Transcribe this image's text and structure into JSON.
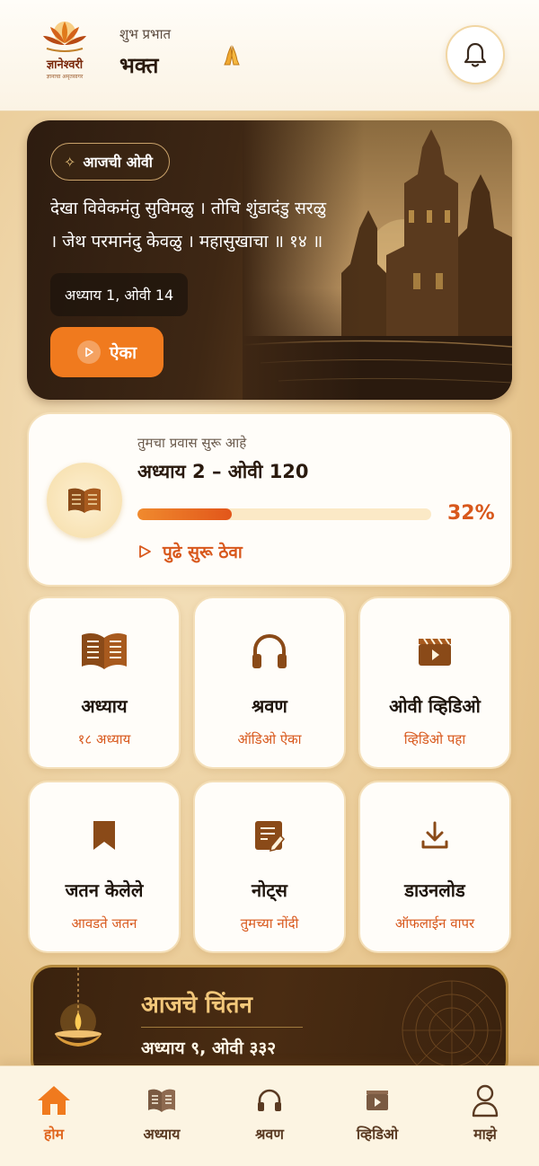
{
  "header": {
    "logo_title": "ज्ञानेश्वरी",
    "logo_subtitle": "ज्ञानाचा अमृतसागर",
    "greeting": "शुभ प्रभात",
    "username": "भक्त"
  },
  "hero": {
    "tag_label": "आजची ओवी",
    "verse_line1": "देखा विवेकमंतु सुविमळु । तोचि शुंडादंडु सरळु",
    "verse_line2": "। जेथ परमानंदु केवळु । महासुखाचा ॥ १४ ॥",
    "reference": "अध्याय 1, ओवी 14",
    "listen_label": "ऐका"
  },
  "progress": {
    "subtitle": "तुमचा प्रवास सुरू आहे",
    "title": "अध्याय 2 – ओवी 120",
    "percent_label": "32%",
    "percent_value": 32,
    "continue_label": "पुढे सुरू ठेवा"
  },
  "tiles": [
    {
      "title": "अध्याय",
      "subtitle": "१८ अध्याय",
      "icon": "open-book-icon"
    },
    {
      "title": "श्रवण",
      "subtitle": "ऑडिओ ऐका",
      "icon": "headphones-icon"
    },
    {
      "title": "ओवी व्हिडिओ",
      "subtitle": "व्हिडिओ पहा",
      "icon": "video-clapper-icon"
    },
    {
      "title": "जतन केलेले",
      "subtitle": "आवडते जतन",
      "icon": "bookmark-icon"
    },
    {
      "title": "नोट्स",
      "subtitle": "तुमच्या नोंदी",
      "icon": "notes-icon"
    },
    {
      "title": "डाउनलोड",
      "subtitle": "ऑफलाईन वापर",
      "icon": "download-icon"
    }
  ],
  "chintan": {
    "title": "आजचे चिंतन",
    "subtitle": "अध्याय ९, ओवी ३३२"
  },
  "nav": [
    {
      "label": "होम",
      "icon": "home-icon",
      "active": true
    },
    {
      "label": "अध्याय",
      "icon": "book-icon",
      "active": false
    },
    {
      "label": "श्रवण",
      "icon": "headphones-icon",
      "active": false
    },
    {
      "label": "व्हिडिओ",
      "icon": "video-icon",
      "active": false
    },
    {
      "label": "माझे",
      "icon": "profile-icon",
      "active": false
    }
  ],
  "colors": {
    "accent": "#f07a1e",
    "accent_text": "#d8581c",
    "icon_brown": "#8a4a18",
    "background": "#f0d9ae"
  }
}
